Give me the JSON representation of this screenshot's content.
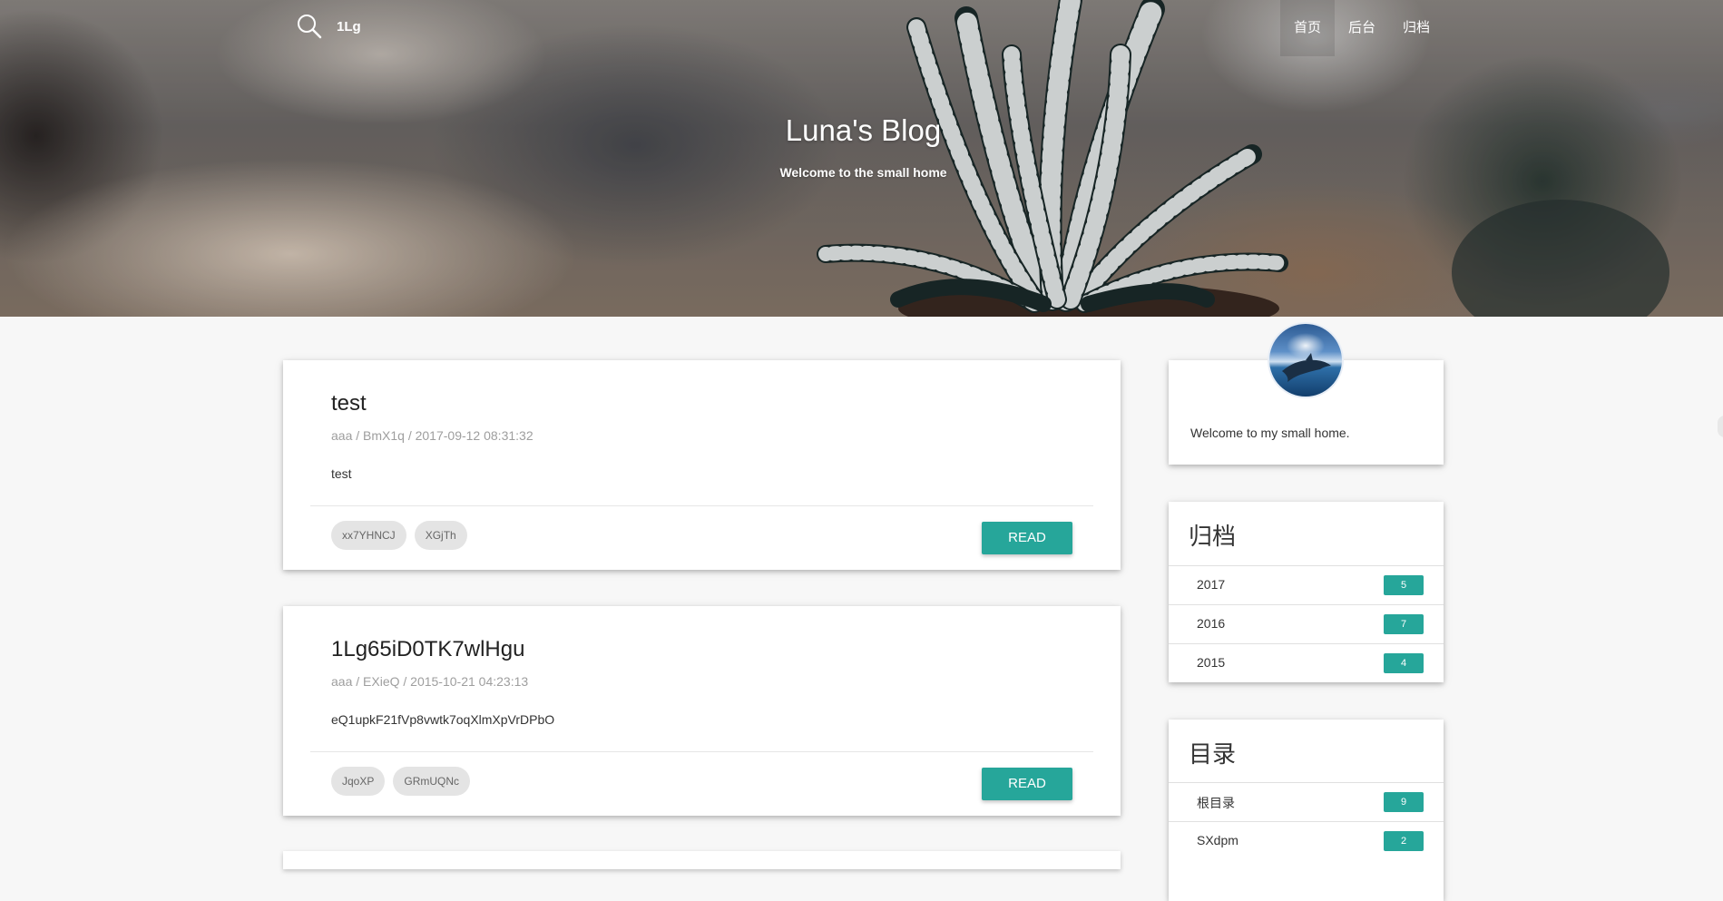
{
  "nav": {
    "search_value": "1Lg",
    "links": [
      "首页",
      "后台",
      "归档"
    ]
  },
  "hero": {
    "title": "Luna's Blog",
    "subtitle": "Welcome to the small home"
  },
  "posts": [
    {
      "title": "test",
      "meta": "aaa / BmX1q / 2017-09-12 08:31:32",
      "excerpt": "test",
      "tags": [
        "xx7YHNCJ",
        "XGjTh"
      ],
      "read_label": "READ"
    },
    {
      "title": "1Lg65iD0TK7wlHgu",
      "meta": "aaa / EXieQ / 2015-10-21 04:23:13",
      "excerpt": "eQ1upkF21fVp8vwtk7oqXlmXpVrDPbO",
      "tags": [
        "JqoXP",
        "GRmUQNc"
      ],
      "read_label": "READ"
    }
  ],
  "profile": {
    "welcome": "Welcome to my small home."
  },
  "archive": {
    "title": "归档",
    "items": [
      {
        "label": "2017",
        "count": "5"
      },
      {
        "label": "2016",
        "count": "7"
      },
      {
        "label": "2015",
        "count": "4"
      }
    ]
  },
  "catalog": {
    "title": "目录",
    "items": [
      {
        "label": "根目录",
        "count": "9"
      },
      {
        "label": "SXdpm",
        "count": "2"
      }
    ]
  },
  "colors": {
    "accent": "#26a69a",
    "page_bg": "#f7f7f7"
  }
}
